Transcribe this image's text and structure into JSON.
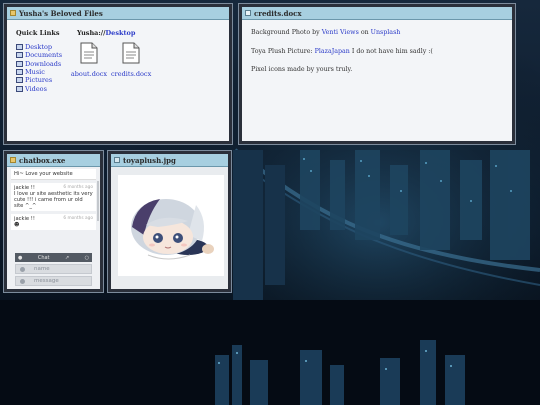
{
  "files_window": {
    "title": "Yusha's Beloved Files",
    "quick_links_title": "Quick Links",
    "quick_links": [
      "Desktop",
      "Documents",
      "Downloads",
      "Music",
      "Pictures",
      "Videos"
    ],
    "path_prefix": "Yusha://",
    "path_current": "Desktop",
    "files": [
      "about.docx",
      "credits.docx"
    ]
  },
  "credits_window": {
    "title": "credits.docx",
    "line1_prefix": "Background Photo by ",
    "line1_author": "Venti Views",
    "line1_mid": " on ",
    "line1_site": "Unsplash",
    "line2_prefix": "Toya Plush Picture: ",
    "line2_link": "PlazaJapan",
    "line2_suffix": " I do not have him sadly :(",
    "line3": "Pixel icons made by yours truly."
  },
  "chat_window": {
    "title": "chatbox.exe",
    "top_message": "Hi~ Love your website",
    "messages": [
      {
        "author": "jackie !!",
        "time": "6 months ago",
        "text": "I love ur site aesthetic its very cute !!! i came from ur old site ^_^"
      },
      {
        "author": "jackie !!",
        "time": "6 months ago",
        "text": ""
      }
    ],
    "bar_label": "Chat",
    "name_placeholder": "name",
    "message_placeholder": "message"
  },
  "plush_window": {
    "title": "toyaplush.jpg"
  },
  "colors": {
    "titlebar": "#a7cfe0",
    "link": "#2a3ac8",
    "window_bg": "#f3f5f8"
  }
}
